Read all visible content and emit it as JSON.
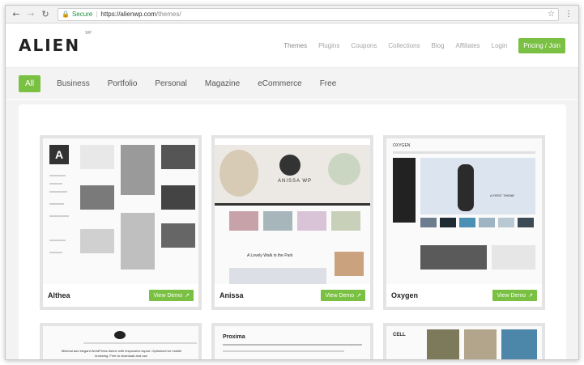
{
  "browser": {
    "secure_label": "Secure",
    "url_host": "https://alienwp.com",
    "url_path": "/themes/"
  },
  "site": {
    "logo": "ALIEN",
    "logo_super": "WP",
    "nav": [
      {
        "label": "Themes",
        "active": true
      },
      {
        "label": "Plugins"
      },
      {
        "label": "Coupons"
      },
      {
        "label": "Collections"
      },
      {
        "label": "Blog"
      },
      {
        "label": "Affiliates"
      },
      {
        "label": "Login"
      }
    ],
    "cta": "Pricing / Join",
    "accent_color": "#7ac143"
  },
  "filters": [
    "All",
    "Business",
    "Portfolio",
    "Personal",
    "Magazine",
    "eCommerce",
    "Free"
  ],
  "themes": [
    {
      "name": "Althea",
      "button": "View Demo"
    },
    {
      "name": "Anissa",
      "button": "View Demo"
    },
    {
      "name": "Oxygen",
      "button": "View Demo"
    }
  ],
  "previews": {
    "althea_logo": "A",
    "anissa_title": "ANISSA WP",
    "anissa_post": "A Lovely Walk in the Park",
    "oxygen_name": "OXYGEN",
    "oxygen_tagline": "A FIRST THEME",
    "bottom_left_text": "Minimal and elegant WordPress theme with responsive layout. Optimized for mobile browsing. Free to download and use.",
    "proxima_name": "Proxima",
    "cell_name": "CELL"
  }
}
